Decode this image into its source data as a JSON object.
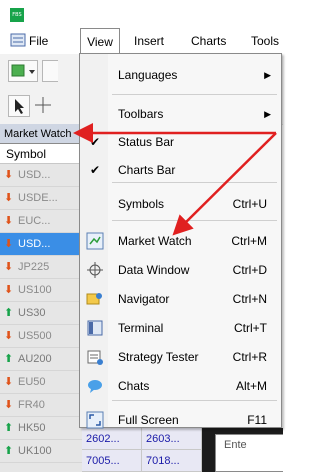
{
  "app": {
    "icon_text": "FBS"
  },
  "menubar": {
    "items": [
      "File",
      "View",
      "Insert",
      "Charts",
      "Tools"
    ]
  },
  "market_watch": {
    "title": "Market Watch",
    "column_symbol": "Symbol",
    "rows": [
      {
        "symbol": "USD...",
        "direction": "down"
      },
      {
        "symbol": "USDE...",
        "direction": "down"
      },
      {
        "symbol": "EUC...",
        "direction": "down"
      },
      {
        "symbol": "USD...",
        "direction": "down",
        "selected": true
      },
      {
        "symbol": "JP225",
        "direction": "down"
      },
      {
        "symbol": "US100",
        "direction": "down"
      },
      {
        "symbol": "US30",
        "direction": "up"
      },
      {
        "symbol": "US500",
        "direction": "down"
      },
      {
        "symbol": "AU200",
        "direction": "up"
      },
      {
        "symbol": "EU50",
        "direction": "down"
      },
      {
        "symbol": "FR40",
        "direction": "down"
      },
      {
        "symbol": "HK50",
        "direction": "up"
      },
      {
        "symbol": "UK100",
        "direction": "up"
      }
    ],
    "prices": [
      {
        "bid": "2602...",
        "ask": "2603..."
      },
      {
        "bid": "7005...",
        "ask": "7018..."
      }
    ]
  },
  "view_menu": {
    "items": [
      {
        "label": "Languages",
        "shortcut": "",
        "submenu": true,
        "checked": false,
        "icon": ""
      },
      {
        "label": "Toolbars",
        "shortcut": "",
        "submenu": true,
        "checked": false,
        "icon": ""
      },
      {
        "label": "Status Bar",
        "shortcut": "",
        "submenu": false,
        "checked": true,
        "icon": ""
      },
      {
        "label": "Charts Bar",
        "shortcut": "",
        "submenu": false,
        "checked": true,
        "icon": ""
      },
      {
        "label": "Symbols",
        "shortcut": "Ctrl+U",
        "submenu": false,
        "checked": false,
        "icon": ""
      },
      {
        "label": "Market Watch",
        "shortcut": "Ctrl+M",
        "submenu": false,
        "checked": false,
        "icon": "market-watch-icon"
      },
      {
        "label": "Data Window",
        "shortcut": "Ctrl+D",
        "submenu": false,
        "checked": false,
        "icon": "crosshair-icon"
      },
      {
        "label": "Navigator",
        "shortcut": "Ctrl+N",
        "submenu": false,
        "checked": false,
        "icon": "navigator-icon"
      },
      {
        "label": "Terminal",
        "shortcut": "Ctrl+T",
        "submenu": false,
        "checked": false,
        "icon": "terminal-icon"
      },
      {
        "label": "Strategy Tester",
        "shortcut": "Ctrl+R",
        "submenu": false,
        "checked": false,
        "icon": "strategy-tester-icon"
      },
      {
        "label": "Chats",
        "shortcut": "Alt+M",
        "submenu": false,
        "checked": false,
        "icon": "chats-icon"
      },
      {
        "label": "Full Screen",
        "shortcut": "F11",
        "submenu": false,
        "checked": false,
        "icon": "full-screen-icon"
      }
    ]
  },
  "terminal": {
    "input_placeholder": "Ente"
  },
  "colors": {
    "arrow": "#e02020",
    "selected_row": "#3a8ee6",
    "up": "#17a34a",
    "down": "#e0531a"
  }
}
